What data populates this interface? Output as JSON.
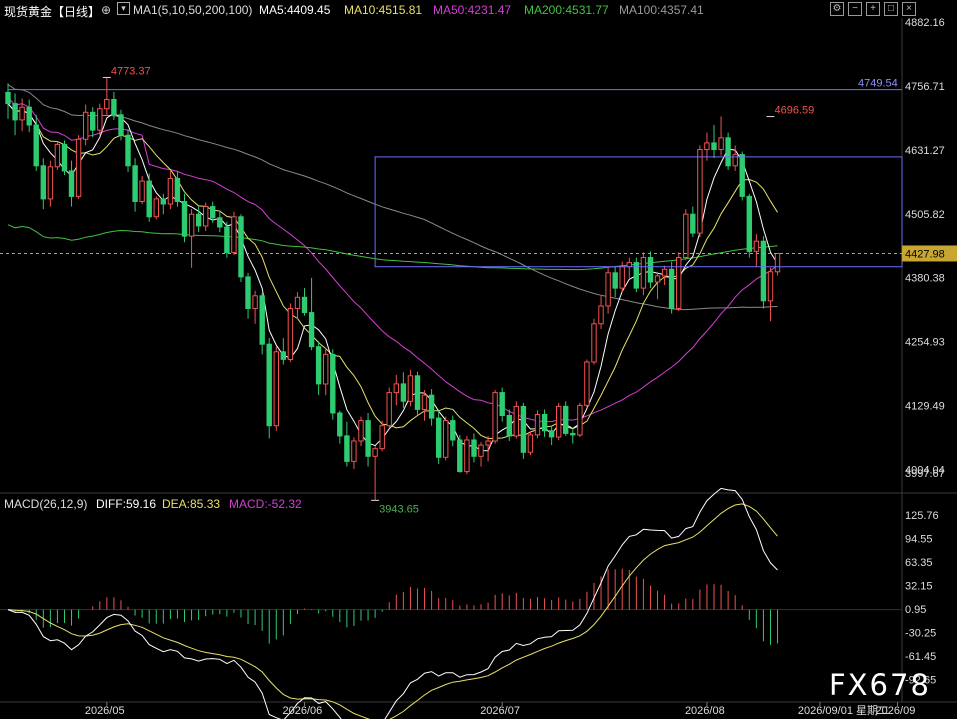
{
  "header": {
    "instrument": "现货黄金",
    "period": "【日线】",
    "ma_title": "MA1(5,10,50,200,100)",
    "ma5": "MA5:4409.45",
    "ma10": "MA10:4515.81",
    "ma50": "MA50:4231.47",
    "ma200": "MA200:4531.77",
    "ma100": "MA100:4357.41"
  },
  "macd_header": {
    "title": "MACD(26,12,9)",
    "diff": "DIFF:59.16",
    "dea": "DEA:85.33",
    "macd": "MACD:-52.32"
  },
  "colors": {
    "up": "#ef5350",
    "down": "#2ecc71",
    "ma5": "#ffffff",
    "ma10": "#e8e06a",
    "ma50": "#d63fd6",
    "ma200": "#3fc43f",
    "ma100": "#8a8a8a",
    "hline": "#6d6dff",
    "last_price_bg": "#c8a632",
    "watermark": "#ffffff"
  },
  "watermark": "FX678",
  "chart_data": [
    {
      "type": "candlestick",
      "title": "现货黄金【日线】",
      "ylim": [
        3960,
        4890
      ],
      "y_ticks": [
        4882.16,
        4756.71,
        4631.27,
        4505.82,
        4380.38,
        4254.93,
        4129.49,
        4004.04
      ],
      "y_tick_labels": [
        "4882.16",
        "4756.71",
        "4631.27",
        "4505.82",
        "4380.38",
        "4254.93",
        "4129.49",
        "4004.04"
      ],
      "x_labels": [
        "2026/05",
        "2026/06",
        "2026/07",
        "2026/08",
        "2026/09/01 星期二",
        "2026/09"
      ],
      "x_label_index": [
        14,
        42,
        70,
        99,
        115,
        126
      ],
      "candles": [
        [
          4744,
          4762,
          4692,
          4722
        ],
        [
          4722,
          4742,
          4660,
          4690
        ],
        [
          4690,
          4732,
          4668,
          4715
        ],
        [
          4715,
          4730,
          4666,
          4680
        ],
        [
          4680,
          4700,
          4590,
          4600
        ],
        [
          4600,
          4615,
          4515,
          4535
        ],
        [
          4535,
          4610,
          4520,
          4598
        ],
        [
          4598,
          4648,
          4592,
          4642
        ],
        [
          4642,
          4650,
          4582,
          4590
        ],
        [
          4590,
          4610,
          4520,
          4540
        ],
        [
          4540,
          4660,
          4535,
          4652
        ],
        [
          4652,
          4720,
          4640,
          4705
        ],
        [
          4705,
          4715,
          4656,
          4670
        ],
        [
          4670,
          4722,
          4660,
          4712
        ],
        [
          4712,
          4773,
          4700,
          4730
        ],
        [
          4730,
          4745,
          4690,
          4700
        ],
        [
          4700,
          4710,
          4650,
          4660
        ],
        [
          4660,
          4672,
          4588,
          4600
        ],
        [
          4600,
          4615,
          4510,
          4530
        ],
        [
          4530,
          4580,
          4525,
          4570
        ],
        [
          4570,
          4585,
          4490,
          4500
        ],
        [
          4500,
          4540,
          4495,
          4535
        ],
        [
          4535,
          4545,
          4505,
          4525
        ],
        [
          4525,
          4590,
          4515,
          4575
        ],
        [
          4575,
          4590,
          4520,
          4530
        ],
        [
          4530,
          4545,
          4450,
          4462
        ],
        [
          4462,
          4515,
          4400,
          4505
        ],
        [
          4505,
          4520,
          4470,
          4482
        ],
        [
          4482,
          4528,
          4472,
          4520
        ],
        [
          4520,
          4530,
          4488,
          4498
        ],
        [
          4498,
          4512,
          4470,
          4480
        ],
        [
          4480,
          4490,
          4420,
          4430
        ],
        [
          4430,
          4510,
          4425,
          4500
        ],
        [
          4500,
          4505,
          4372,
          4382
        ],
        [
          4382,
          4390,
          4300,
          4320
        ],
        [
          4320,
          4355,
          4290,
          4345
        ],
        [
          4345,
          4350,
          4230,
          4250
        ],
        [
          4250,
          4262,
          4065,
          4090
        ],
        [
          4090,
          4245,
          4080,
          4235
        ],
        [
          4235,
          4262,
          4210,
          4220
        ],
        [
          4220,
          4330,
          4215,
          4320
        ],
        [
          4320,
          4352,
          4300,
          4342
        ],
        [
          4342,
          4360,
          4306,
          4312
        ],
        [
          4312,
          4380,
          4238,
          4245
        ],
        [
          4245,
          4256,
          4150,
          4172
        ],
        [
          4172,
          4242,
          4150,
          4230
        ],
        [
          4230,
          4240,
          4102,
          4115
        ],
        [
          4115,
          4120,
          4055,
          4070
        ],
        [
          4070,
          4098,
          4010,
          4020
        ],
        [
          4020,
          4067,
          4005,
          4060
        ],
        [
          4060,
          4108,
          4050,
          4100
        ],
        [
          4100,
          4115,
          4010,
          4030
        ],
        [
          4030,
          4050,
          3943,
          4045
        ],
        [
          4045,
          4100,
          4040,
          4090
        ],
        [
          4090,
          4165,
          4085,
          4155
        ],
        [
          4155,
          4190,
          4130,
          4172
        ],
        [
          4172,
          4195,
          4125,
          4138
        ],
        [
          4138,
          4200,
          4128,
          4188
        ],
        [
          4188,
          4196,
          4112,
          4122
        ],
        [
          4122,
          4160,
          4100,
          4150
        ],
        [
          4150,
          4162,
          4090,
          4105
        ],
        [
          4105,
          4120,
          4015,
          4028
        ],
        [
          4028,
          4108,
          4022,
          4100
        ],
        [
          4100,
          4110,
          4050,
          4062
        ],
        [
          4062,
          4072,
          3998,
          4000
        ],
        [
          4000,
          4070,
          3995,
          4062
        ],
        [
          4062,
          4075,
          4018,
          4030
        ],
        [
          4030,
          4058,
          4010,
          4052
        ],
        [
          4052,
          4070,
          4020,
          4060
        ],
        [
          4060,
          4160,
          4055,
          4155
        ],
        [
          4155,
          4165,
          4098,
          4110
        ],
        [
          4110,
          4122,
          4060,
          4070
        ],
        [
          4070,
          4138,
          4065,
          4128
        ],
        [
          4128,
          4135,
          4025,
          4038
        ],
        [
          4038,
          4078,
          4032,
          4072
        ],
        [
          4072,
          4120,
          4066,
          4112
        ],
        [
          4112,
          4122,
          4068,
          4080
        ],
        [
          4080,
          4090,
          4052,
          4068
        ],
        [
          4068,
          4135,
          4062,
          4128
        ],
        [
          4128,
          4138,
          4070,
          4075
        ],
        [
          4075,
          4085,
          4055,
          4072
        ],
        [
          4072,
          4135,
          4068,
          4130
        ],
        [
          4130,
          4220,
          4125,
          4215
        ],
        [
          4215,
          4300,
          4210,
          4290
        ],
        [
          4290,
          4345,
          4280,
          4325
        ],
        [
          4325,
          4400,
          4310,
          4390
        ],
        [
          4390,
          4402,
          4342,
          4360
        ],
        [
          4360,
          4412,
          4352,
          4402
        ],
        [
          4402,
          4420,
          4380,
          4410
        ],
        [
          4410,
          4420,
          4352,
          4360
        ],
        [
          4360,
          4430,
          4346,
          4420
        ],
        [
          4420,
          4432,
          4360,
          4372
        ],
        [
          4372,
          4392,
          4338,
          4384
        ],
        [
          4384,
          4404,
          4366,
          4397
        ],
        [
          4397,
          4412,
          4310,
          4320
        ],
        [
          4320,
          4430,
          4315,
          4420
        ],
        [
          4420,
          4515,
          4415,
          4505
        ],
        [
          4505,
          4520,
          4460,
          4468
        ],
        [
          4468,
          4640,
          4460,
          4632
        ],
        [
          4632,
          4665,
          4610,
          4645
        ],
        [
          4645,
          4680,
          4615,
          4632
        ],
        [
          4632,
          4697,
          4620,
          4655
        ],
        [
          4655,
          4665,
          4592,
          4600
        ],
        [
          4600,
          4640,
          4590,
          4622
        ],
        [
          4622,
          4628,
          4532,
          4540
        ],
        [
          4540,
          4545,
          4420,
          4432
        ],
        [
          4432,
          4466,
          4402,
          4452
        ],
        [
          4452,
          4462,
          4320,
          4335
        ],
        [
          4335,
          4400,
          4295,
          4392
        ],
        [
          4392,
          4428,
          4385,
          4428
        ]
      ],
      "highlights": [
        {
          "label": "4773.37",
          "index": 14,
          "price": 4773.37,
          "color": "#ef5350"
        },
        {
          "label": "3943.65",
          "index": 52,
          "price": 3943.65,
          "color": "#4caf50"
        },
        {
          "label": "4696.59",
          "index": 108,
          "price": 4696.59,
          "color": "#ef5350"
        }
      ],
      "hlines": [
        {
          "price": 4749.54,
          "label": "4749.54"
        }
      ],
      "last_price": {
        "price": 4427.98,
        "label": "4427.98"
      },
      "extra_label": {
        "price": 3997.67,
        "label": "3997.67"
      },
      "box": {
        "from_index": 52,
        "to_index": 130,
        "high": 4617.5,
        "low": 4402
      }
    },
    {
      "type": "macd",
      "title": "MACD(26,12,9)",
      "ylim": [
        -120,
        135
      ],
      "y_ticks": [
        125.76,
        94.55,
        63.35,
        32.15,
        0.95,
        -30.25,
        -61.45,
        -92.65
      ],
      "y_tick_labels": [
        "125.76",
        "94.55",
        "63.35",
        "32.15",
        "0.95",
        "-30.25",
        "-61.45",
        "-92.65"
      ],
      "series": [
        {
          "name": "DIFF",
          "last": 59.16
        },
        {
          "name": "DEA",
          "last": 85.33
        },
        {
          "name": "MACD",
          "last": -52.32
        }
      ]
    }
  ]
}
